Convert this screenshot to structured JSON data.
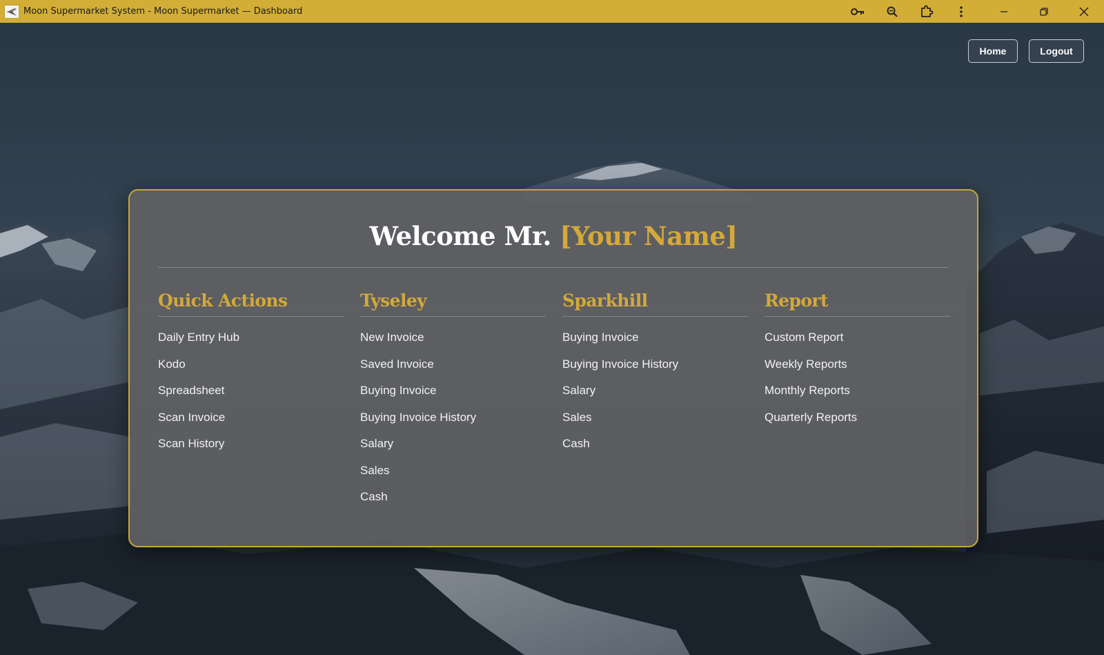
{
  "window": {
    "title": "Moon Supermarket System - Moon Supermarket — Dashboard",
    "toolbar_icons": [
      "key-icon",
      "zoom-icon",
      "extensions-icon",
      "more-icon"
    ],
    "controls": [
      "minimize",
      "restore",
      "close"
    ],
    "accent_color": "#d3ae36"
  },
  "nav": {
    "home_label": "Home",
    "logout_label": "Logout"
  },
  "card": {
    "welcome_prefix": "Welcome Mr.",
    "welcome_name": "[Your Name]",
    "accent_color": "#d4a83a",
    "columns": [
      {
        "title": "Quick Actions",
        "items": [
          "Daily Entry Hub",
          "Kodo",
          "Spreadsheet",
          "Scan Invoice",
          "Scan History"
        ]
      },
      {
        "title": "Tyseley",
        "items": [
          "New Invoice",
          "Saved Invoice",
          "Buying Invoice",
          "Buying Invoice History",
          "Salary",
          "Sales",
          "Cash"
        ]
      },
      {
        "title": "Sparkhill",
        "items": [
          "Buying Invoice",
          "Buying Invoice History",
          "Salary",
          "Sales",
          "Cash"
        ]
      },
      {
        "title": "Report",
        "items": [
          "Custom Report",
          "Weekly Reports",
          "Monthly Reports",
          "Quarterly Reports"
        ]
      }
    ]
  }
}
